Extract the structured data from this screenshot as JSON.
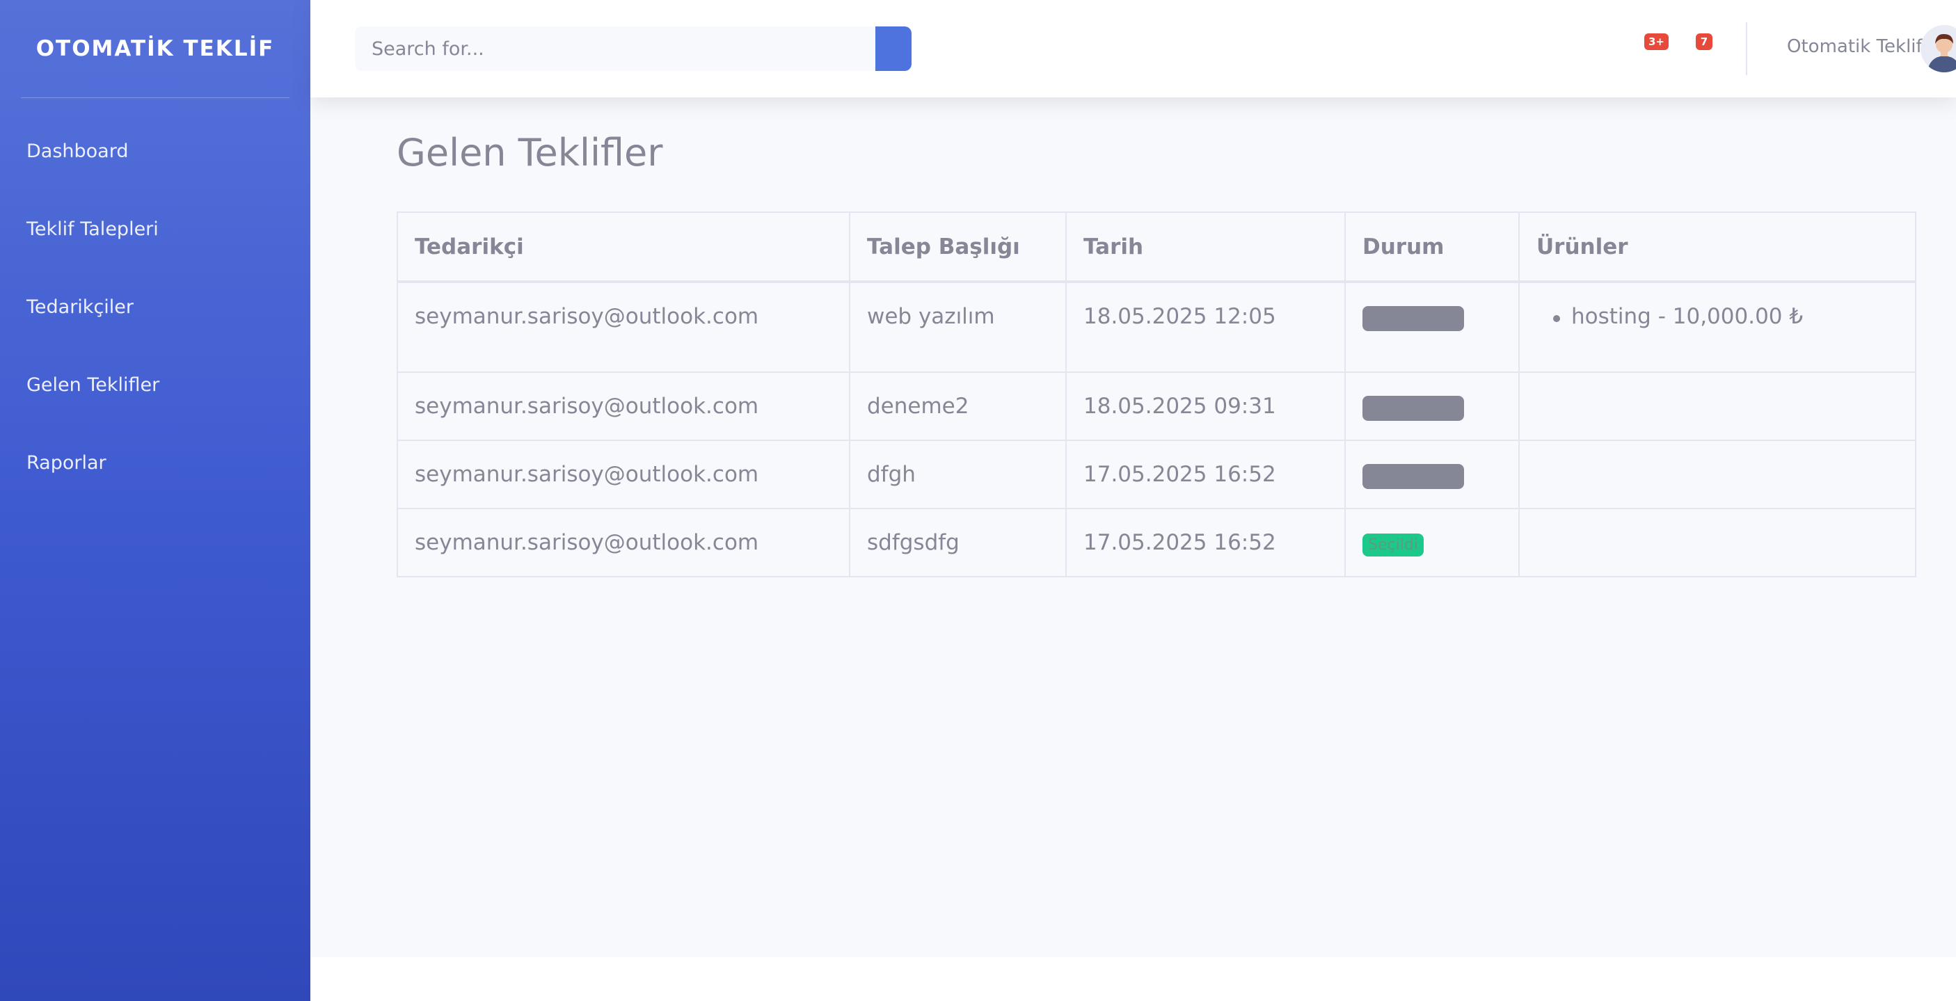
{
  "sidebar": {
    "brand": "OTOMATİK TEKLİF",
    "items": [
      {
        "label": "Dashboard"
      },
      {
        "label": "Teklif Talepleri"
      },
      {
        "label": "Tedarikçiler"
      },
      {
        "label": "Gelen Teklifler"
      },
      {
        "label": "Raporlar"
      }
    ]
  },
  "topbar": {
    "search_placeholder": "Search for...",
    "alerts_badge": "3+",
    "messages_badge": "7",
    "user_name": "Otomatik Teklif"
  },
  "main": {
    "title": "Gelen Teklifler",
    "table": {
      "headers": [
        "Tedarikçi",
        "Talep Başlığı",
        "Tarih",
        "Durum",
        "Ürünler"
      ],
      "rows": [
        {
          "supplier": "seymanur.sarisoy@outlook.com",
          "title": "web yazılım",
          "date": "18.05.2025 12:05",
          "status": "",
          "status_color": "#858796",
          "products": [
            "hosting - 10,000.00 ₺"
          ]
        },
        {
          "supplier": "seymanur.sarisoy@outlook.com",
          "title": "deneme2",
          "date": "18.05.2025 09:31",
          "status": "",
          "status_color": "#858796",
          "products": []
        },
        {
          "supplier": "seymanur.sarisoy@outlook.com",
          "title": "dfgh",
          "date": "17.05.2025 16:52",
          "status": "",
          "status_color": "#858796",
          "products": []
        },
        {
          "supplier": "seymanur.sarisoy@outlook.com",
          "title": "sdfgsdfg",
          "date": "17.05.2025 16:52",
          "status": "Seçildi",
          "status_color": "#1cc88a",
          "products": []
        }
      ]
    }
  },
  "colors": {
    "accent": "#4e73df",
    "danger": "#e74a3b",
    "success": "#1cc88a",
    "text_muted": "#858796"
  }
}
